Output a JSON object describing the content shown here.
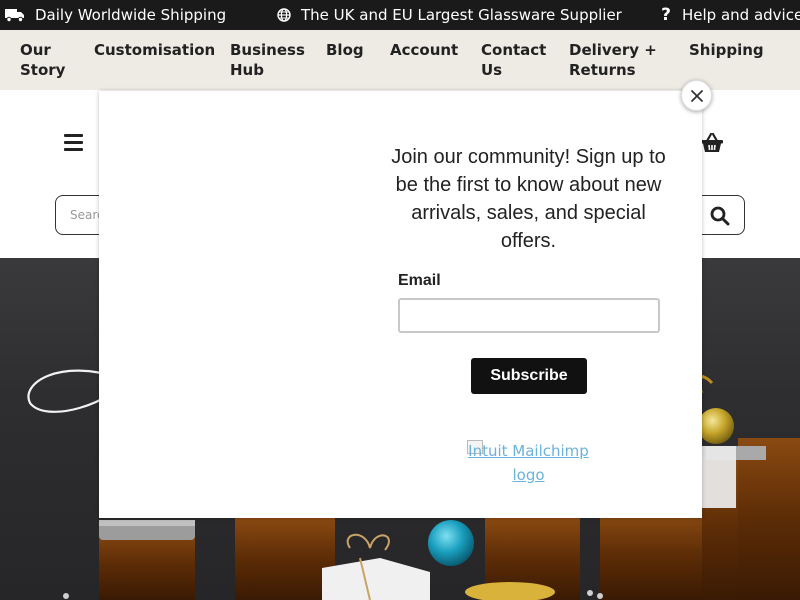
{
  "topbar": {
    "shipping_text": "Daily Worldwide Shipping",
    "supplier_text": "The UK and EU Largest Glassware Supplier",
    "help_text": "Help and advice",
    "icons": [
      "truck-icon",
      "globe-icon",
      "question-icon"
    ]
  },
  "nav": {
    "items": [
      {
        "label": "Our\nStory"
      },
      {
        "label": "Customisation"
      },
      {
        "label": "Business\nHub"
      },
      {
        "label": "Blog"
      },
      {
        "label": "Account"
      },
      {
        "label": "Contact\nUs"
      },
      {
        "label": "Delivery +\nReturns"
      },
      {
        "label": "Shipping"
      }
    ]
  },
  "header": {
    "search_placeholder": "Search",
    "icons": [
      "menu-icon",
      "basket-icon",
      "search-icon"
    ]
  },
  "modal": {
    "heading": "Join our community! Sign up to be the first to know about new arrivals, sales, and special offers.",
    "email_label": "Email",
    "email_value": "",
    "subscribe_label": "Subscribe",
    "logo_alt": "Intuit Mailchimp logo",
    "close_icon": "close-icon"
  },
  "colors": {
    "topbar_bg": "#1a1a1a",
    "nav_bg": "#eeeae4",
    "button_bg": "#111111",
    "link_color": "#6bb3d9"
  }
}
